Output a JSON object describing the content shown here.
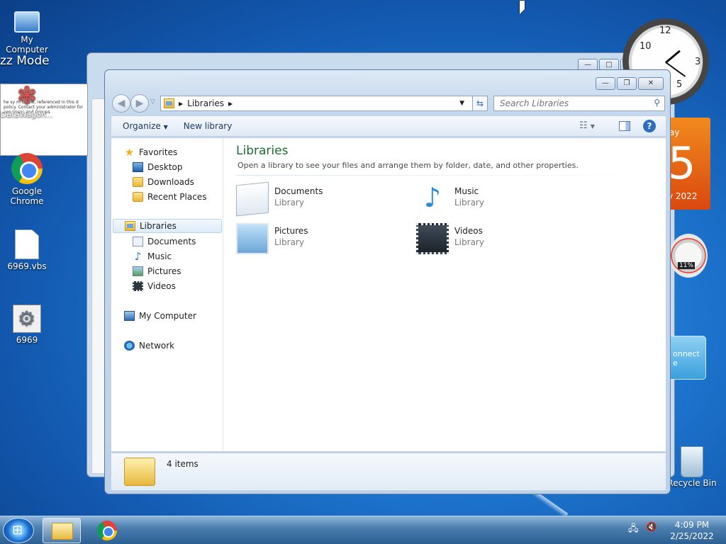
{
  "desktop": {
    "icons": [
      {
        "label": "My Computer"
      },
      {
        "label": "DataWagon..."
      },
      {
        "label": "Google Chrome"
      },
      {
        "label": "6969.vbs"
      },
      {
        "label": "6969"
      },
      {
        "label": "Recycle Bin"
      }
    ],
    "fragment_mode": "zz Mode",
    "popup_lines": [
      "he sy    m below, referenced in this d",
      "policy. Contact your administrator for",
      "   see    Users and Groups"
    ]
  },
  "gadgets": {
    "calendar_day_fragment": "ay",
    "calendar_date_fragment": "5",
    "calendar_year_fragment": "y 2022",
    "cpu_meter_percent": "11%",
    "connect_fragment": "onnect",
    "connect_fragment2": "e"
  },
  "explorer": {
    "address": {
      "crumb": "Libraries"
    },
    "search": {
      "placeholder": "Search Libraries"
    },
    "toolbar": {
      "organize_label": "Organize",
      "new_library_label": "New library"
    },
    "nav": {
      "favorites": "Favorites",
      "favorites_items": [
        "Desktop",
        "Downloads",
        "Recent Places"
      ],
      "libraries": "Libraries",
      "libraries_items": [
        "Documents",
        "Music",
        "Pictures",
        "Videos"
      ],
      "computer": "My Computer",
      "network": "Network"
    },
    "main": {
      "title": "Libraries",
      "description": "Open a library to see your files and arrange them by folder, date, and other properties.",
      "libraries": [
        {
          "name": "Documents",
          "type": "Library"
        },
        {
          "name": "Music",
          "type": "Library"
        },
        {
          "name": "Pictures",
          "type": "Library"
        },
        {
          "name": "Videos",
          "type": "Library"
        }
      ]
    },
    "status": {
      "count": "4 items"
    }
  },
  "taskbar": {
    "time": "4:09 PM",
    "date": "2/25/2022"
  }
}
